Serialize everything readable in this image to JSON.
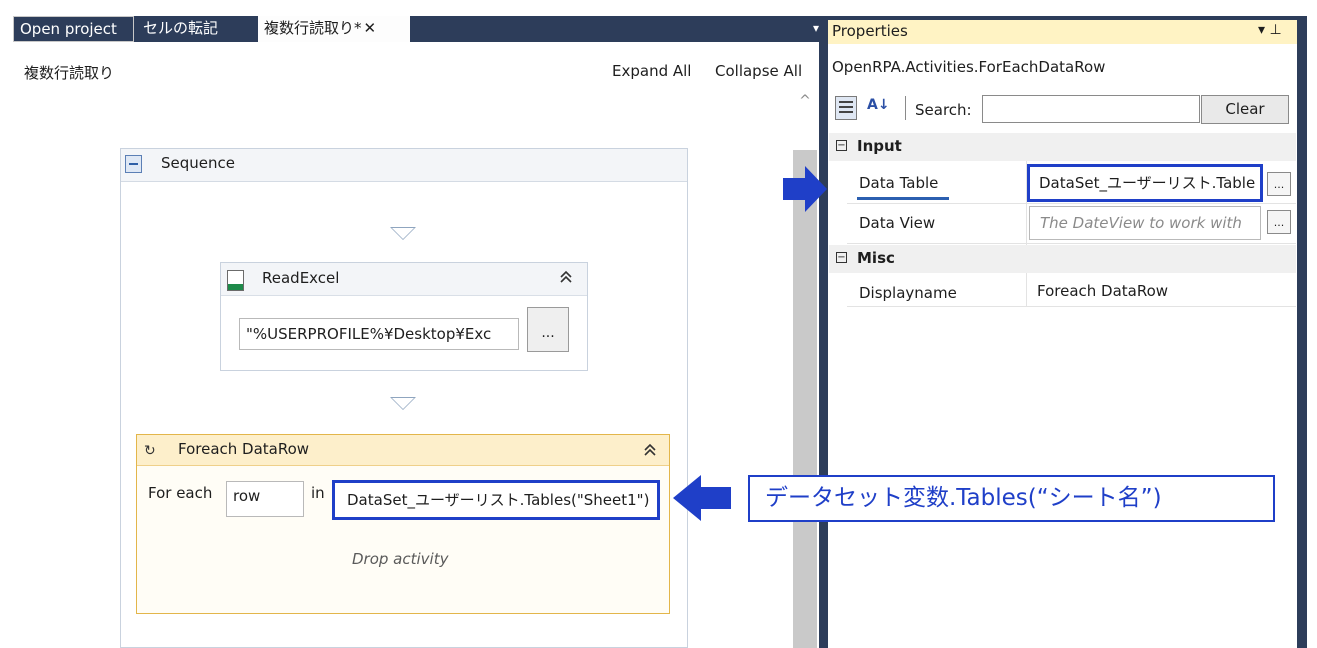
{
  "tabs": {
    "open_project": "Open project",
    "cell_transfer": "セルの転記",
    "multi_row_read": "複数行読取り*",
    "close_glyph": "✕",
    "dropdown_glyph": "▾"
  },
  "designer": {
    "breadcrumb": "複数行読取り",
    "expand_all": "Expand All",
    "collapse_all": "Collapse All",
    "scroll_up_glyph": "^"
  },
  "sequence": {
    "title": "Sequence"
  },
  "read_excel": {
    "title": "ReadExcel",
    "path_value": "\"%USERPROFILE%¥Desktop¥Exc",
    "browse_label": "...",
    "collapse_glyph": "≈"
  },
  "foreach": {
    "icon_glyph": "↻",
    "title": "Foreach DataRow",
    "collapse_glyph": "≈",
    "for_each_label": "For each",
    "item_value": "row",
    "in_label": "in",
    "table_value": "DataSet_ユーザーリスト.Tables(\"Sheet1\")",
    "drop_hint": "Drop activity"
  },
  "properties": {
    "title": "Properties",
    "title_icons": "▾ ⊥",
    "class_name": "OpenRPA.Activities.ForEachDataRow",
    "sort_az_glyph": "A↓",
    "search_label": "Search:",
    "search_value": "",
    "clear_label": "Clear",
    "categories": [
      {
        "toggle": "−",
        "name": "Input",
        "rows": [
          {
            "name": "Data Table",
            "value": "DataSet_ユーザーリスト.Table",
            "button": "..."
          },
          {
            "name": "Data View",
            "value": "The DateView to work with",
            "button": "..."
          }
        ]
      },
      {
        "toggle": "−",
        "name": "Misc",
        "rows": [
          {
            "name": "Displayname",
            "value": "Foreach DataRow"
          }
        ]
      }
    ]
  },
  "callout": {
    "text": "データセット変数.Tables(“シート名”)"
  },
  "colors": {
    "highlight_blue": "#1f3fc8",
    "frame_dark": "#2d3d5a",
    "properties_title_bg": "#fff3c4",
    "foreach_header_bg": "#fdefcb"
  }
}
